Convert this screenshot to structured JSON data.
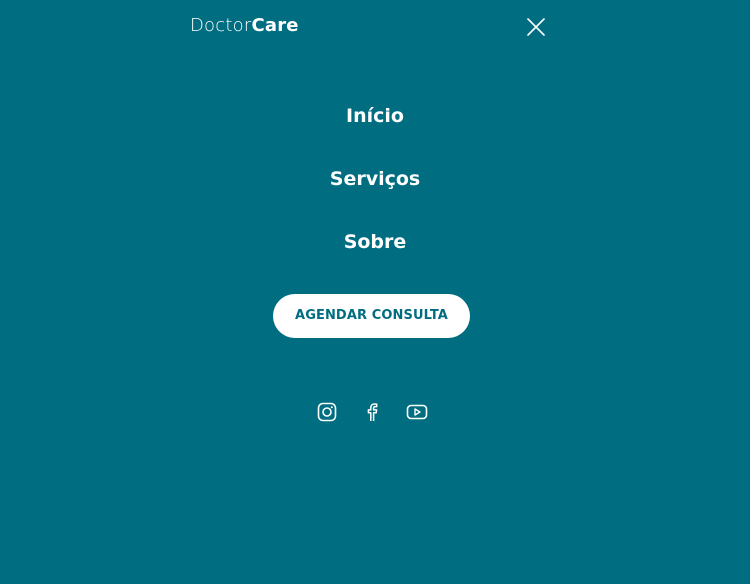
{
  "header": {
    "logo_light": "Doctor",
    "logo_bold": "Care",
    "close_icon": "close-icon"
  },
  "nav": {
    "items": [
      {
        "label": "Início"
      },
      {
        "label": "Serviços"
      },
      {
        "label": "Sobre"
      }
    ]
  },
  "cta": {
    "label": "AGENDAR CONSULTA"
  },
  "social": {
    "icons": [
      "instagram-icon",
      "facebook-icon",
      "youtube-icon"
    ]
  },
  "colors": {
    "background": "#006d80",
    "text": "#ffffff",
    "button_bg": "#ffffff",
    "button_text": "#006d80"
  }
}
